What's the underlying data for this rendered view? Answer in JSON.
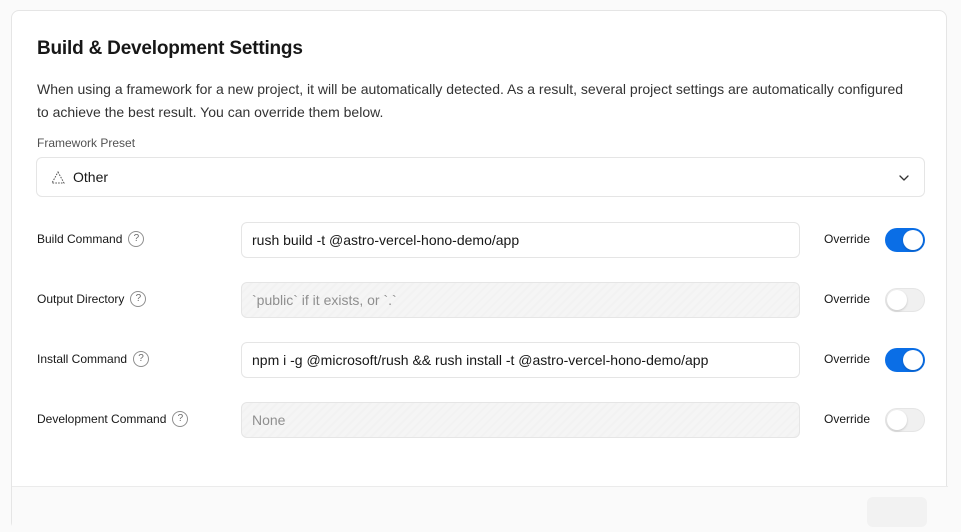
{
  "title": "Build & Development Settings",
  "description": "When using a framework for a new project, it will be automatically detected. As a result, several project settings are automatically configured to achieve the best result. You can override them below.",
  "framework": {
    "label": "Framework Preset",
    "value": "Other",
    "icon": "triangle-outline-icon"
  },
  "override_label": "Override",
  "help_glyph": "?",
  "rows": [
    {
      "label": "Build Command",
      "value": "rush build -t @astro-vercel-hono-demo/app",
      "placeholder": "",
      "override": true
    },
    {
      "label": "Output Directory",
      "value": "",
      "placeholder": "`public` if it exists, or `.`",
      "override": false
    },
    {
      "label": "Install Command",
      "value": "npm i -g @microsoft/rush && rush install -t @astro-vercel-hono-demo/app",
      "placeholder": "",
      "override": true
    },
    {
      "label": "Development Command",
      "value": "",
      "placeholder": "None",
      "override": false
    }
  ],
  "colors": {
    "toggle_on": "#0a6ee6",
    "toggle_off": "#f0f0f0"
  }
}
